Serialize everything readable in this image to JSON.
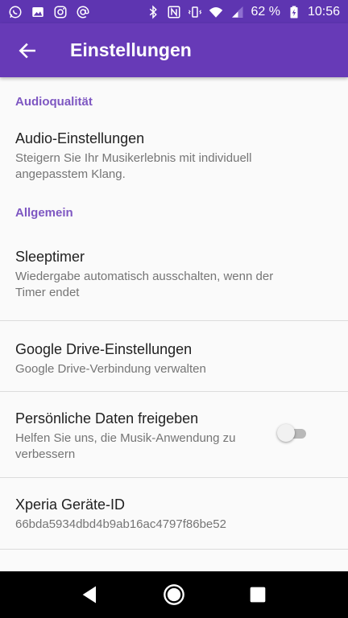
{
  "status_bar": {
    "battery_percent": "62 %",
    "time": "10:56",
    "left_icons": [
      "whatsapp-icon",
      "image-icon",
      "instagram-icon",
      "at-icon"
    ],
    "right_icons": [
      "bluetooth-icon",
      "nfc-icon",
      "vibrate-icon",
      "wifi-icon",
      "signal-icon",
      "battery-charging-icon"
    ]
  },
  "app_bar": {
    "title": "Einstellungen",
    "back_icon": "arrow-back-icon"
  },
  "sections": {
    "audio": {
      "header": "Audioqualität",
      "audio_settings": {
        "title": "Audio-Einstellungen",
        "summary": "Steigern Sie Ihr Musikerlebnis mit individuell angepasstem Klang."
      }
    },
    "general": {
      "header": "Allgemein",
      "sleeptimer": {
        "title": "Sleeptimer",
        "summary": "Wiedergabe automatisch ausschalten, wenn der Timer endet"
      },
      "google_drive": {
        "title": "Google Drive-Einstellungen",
        "summary": "Google Drive-Verbindung verwalten"
      },
      "share_data": {
        "title": "Persönliche Daten freigeben",
        "summary": "Helfen Sie uns, die Musik-Anwendung zu verbessern",
        "toggle_on": false
      },
      "device_id": {
        "title": "Xperia Geräte-ID",
        "summary": "66bda5934dbd4b9ab16ac4797f86be52"
      }
    }
  },
  "colors": {
    "status_bar": "#5e35b1",
    "app_bar": "#673ab7",
    "accent": "#7e57c2"
  },
  "nav_bar": {
    "icons": [
      "back-triangle-icon",
      "home-circle-icon",
      "recents-square-icon"
    ]
  }
}
